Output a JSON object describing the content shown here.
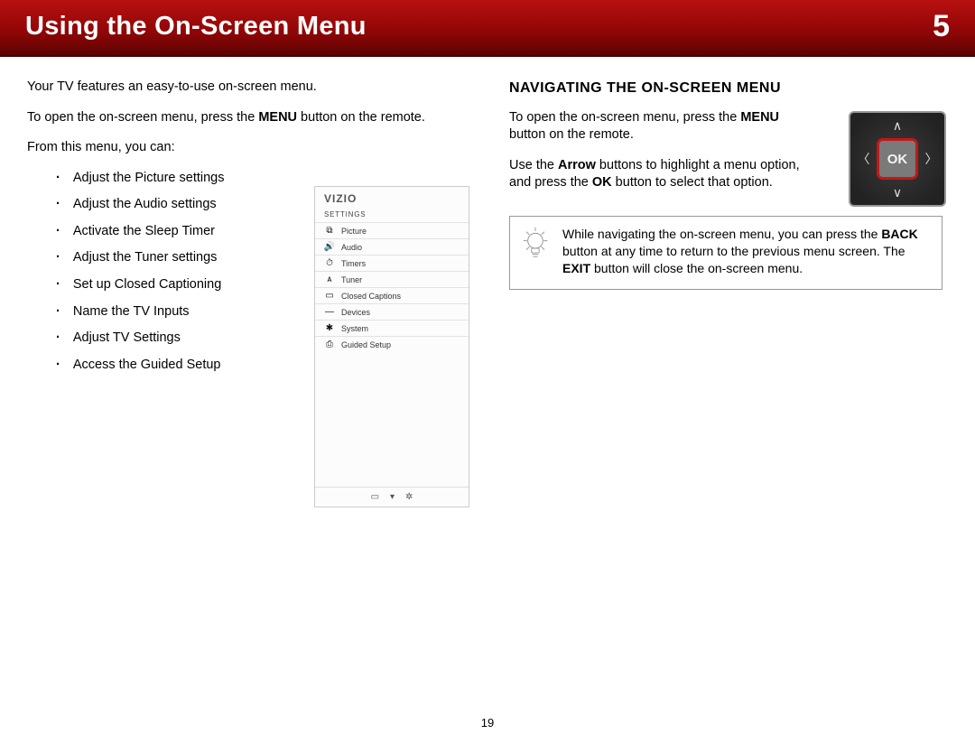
{
  "header": {
    "title": "Using the On-Screen Menu",
    "chapter": "5"
  },
  "left": {
    "p1": "Your TV features an easy-to-use on-screen menu.",
    "p2a": "To open the on-screen menu, press the ",
    "p2b": "MENU",
    "p2c": " button on the remote.",
    "p3": "From this menu, you can:",
    "actions": [
      "Adjust the Picture settings",
      "Adjust the Audio settings",
      "Activate the Sleep Timer",
      "Adjust the Tuner settings",
      "Set up Closed Captioning",
      "Name the TV Inputs",
      "Adjust TV Settings",
      "Access the Guided Setup"
    ]
  },
  "osd": {
    "brand": "VIZIO",
    "section": "SETTINGS",
    "rows": [
      {
        "icon": "⧉",
        "label": "Picture"
      },
      {
        "icon": "🔊",
        "label": "Audio"
      },
      {
        "icon": "⏱",
        "label": "Timers"
      },
      {
        "icon": "ᴀ",
        "label": "Tuner"
      },
      {
        "icon": "▭",
        "label": "Closed Captions"
      },
      {
        "icon": "—",
        "label": "Devices"
      },
      {
        "icon": "✱",
        "label": "System"
      },
      {
        "icon": "⎙",
        "label": "Guided Setup"
      }
    ],
    "footer": [
      "▭",
      "▾",
      "✲"
    ]
  },
  "right": {
    "heading": "NAVIGATING THE ON-SCREEN MENU",
    "p1a": "To open the on-screen menu, press the ",
    "p1b": "MENU",
    "p1c": " button on the remote.",
    "p2a": "Use the ",
    "p2b": "Arrow",
    "p2c": " buttons to highlight a menu option, and press the ",
    "p2d": "OK",
    "p2e": " button to select that option.",
    "remote_ok": "OK"
  },
  "tip": {
    "t1": "While navigating the on-screen menu, you can press the ",
    "t2": "BACK",
    "t3": " button at any time to return to the previous menu screen. The ",
    "t4": "EXIT",
    "t5": " button will close the on-screen menu."
  },
  "page_number": "19"
}
